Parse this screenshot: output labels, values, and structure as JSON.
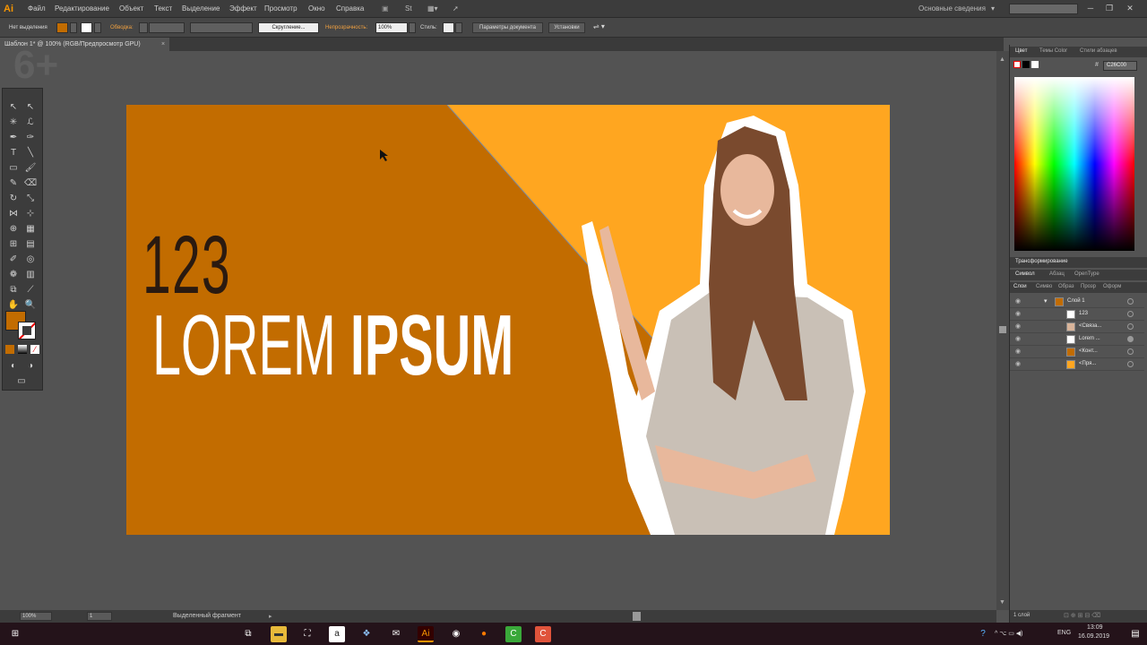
{
  "app": {
    "logo": "Ai",
    "workspace": "Основные сведения"
  },
  "menu": [
    "Файл",
    "Редактирование",
    "Объект",
    "Текст",
    "Выделение",
    "Эффект",
    "Просмотр",
    "Окно",
    "Справка"
  ],
  "control": {
    "selection": "Нет выделения",
    "stroke_label": "Обводка:",
    "brush": "Скругление...",
    "opacity_label": "Непрозрачность:",
    "opacity_value": "100%",
    "style_label": "Стиль:",
    "doc_settings": "Параметры документа",
    "preferences": "Установки"
  },
  "document": {
    "tab": "Шаблон 1* @ 100% (RGB/Предпросмотр GPU)"
  },
  "artboard": {
    "number": "123",
    "title_light": "LOREM ",
    "title_bold": "IPSUM",
    "color_dark": "#c26c00",
    "color_light": "#ffa620"
  },
  "panels": {
    "color_tabs": [
      "Цвет",
      "Темы Color",
      "Стили абзацев"
    ],
    "hex": "C26C00",
    "transform": "Трансформирование",
    "char_tabs": [
      "Символ",
      "Абзац",
      "OpenType"
    ],
    "layer_tabs": [
      "Слои",
      "Симво",
      "Образ",
      "Прозр",
      "Оформ"
    ],
    "layers": [
      {
        "name": "Слой 1"
      },
      {
        "name": "123"
      },
      {
        "name": "<Связа..."
      },
      {
        "name": "Lorem ..."
      },
      {
        "name": "<Конт..."
      },
      {
        "name": "<Пря..."
      }
    ],
    "layers_count": "1 слой"
  },
  "status": {
    "zoom": "100%",
    "page": "1",
    "mode": "Выделенный фрагмент"
  },
  "taskbar": {
    "lang": "ENG",
    "time": "13:09",
    "date": "16.09.2019"
  },
  "watermark": "6+"
}
